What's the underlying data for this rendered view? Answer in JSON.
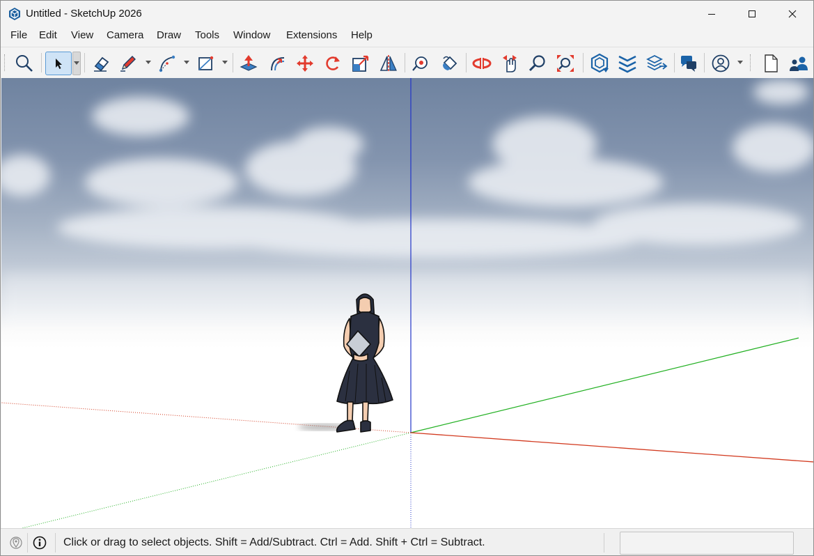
{
  "window": {
    "title": "Untitled - SketchUp 2026"
  },
  "menu": {
    "items": [
      {
        "label": "File"
      },
      {
        "label": "Edit"
      },
      {
        "label": "View"
      },
      {
        "label": "Camera"
      },
      {
        "label": "Draw"
      },
      {
        "label": "Tools"
      },
      {
        "label": "Window"
      },
      {
        "label": "Extensions"
      },
      {
        "label": "Help"
      }
    ]
  },
  "toolbar": {
    "tools": [
      "search-icon",
      "select-icon",
      "eraser-icon",
      "pencil-line-icon",
      "arc-icon",
      "rectangle-icon",
      "push-pull-icon",
      "offset-icon",
      "move-icon",
      "rotate-icon",
      "scale-icon",
      "flip-icon",
      "tape-measure-icon",
      "paint-bucket-icon",
      "orbit-icon",
      "pan-icon",
      "zoom-icon",
      "zoom-extents-icon",
      "3d-warehouse-icon",
      "extension-warehouse-icon",
      "layout-icon",
      "chat-icon",
      "account-icon",
      "new-file-icon",
      "collaborate-icon"
    ],
    "active_tool": "select-icon"
  },
  "status": {
    "message": "Click or drag to select objects. Shift = Add/Subtract. Ctrl = Add. Shift + Ctrl = Subtract.",
    "measurements_value": ""
  },
  "colors": {
    "accent": "#1b63a8",
    "axis_red": "#d23a1f",
    "axis_green": "#2fb02f",
    "axis_blue": "#2235c8",
    "sky_top": "#6f83a0"
  }
}
